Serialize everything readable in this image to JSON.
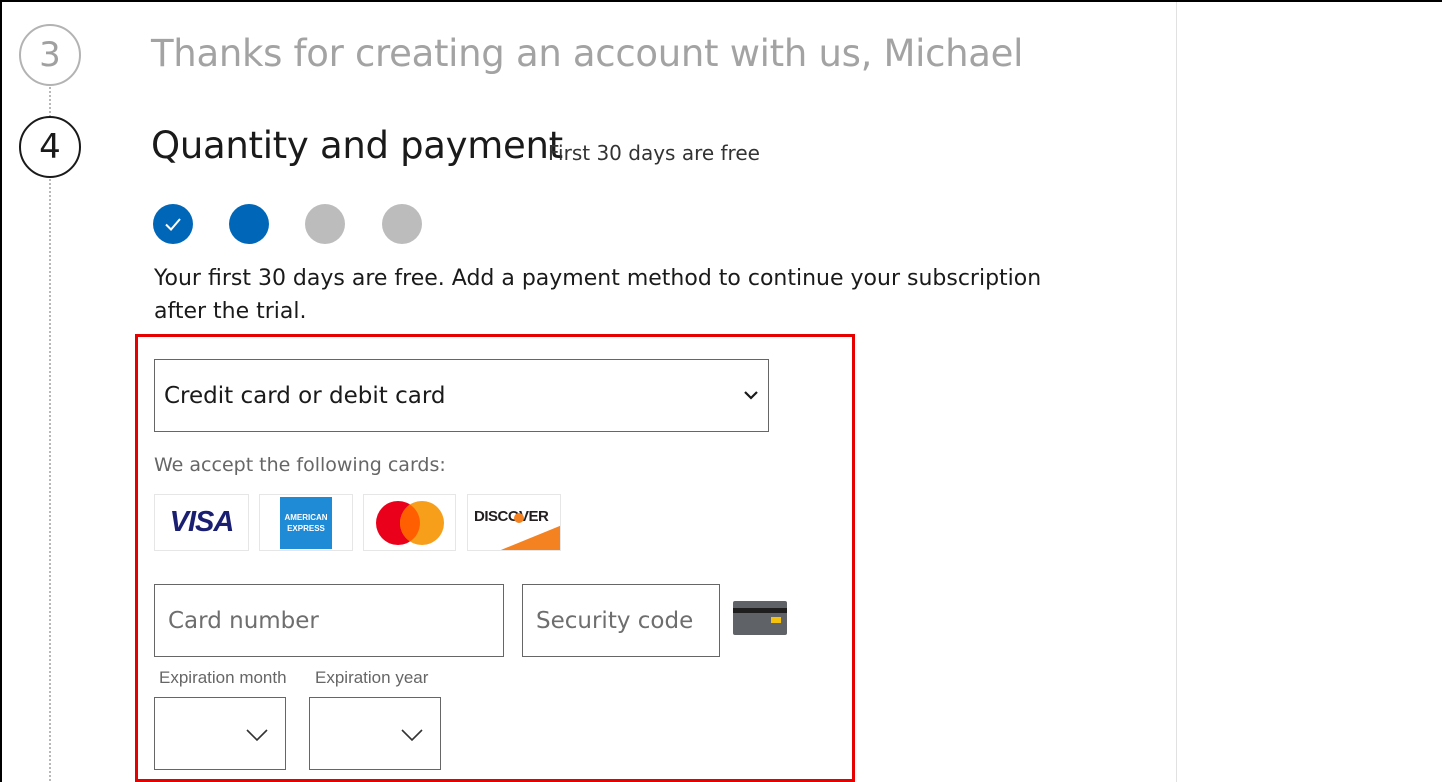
{
  "steps": {
    "step3": {
      "number": "3",
      "title": "Thanks for creating an account with us, Michael"
    },
    "step4": {
      "number": "4",
      "title": "Quantity and payment",
      "subtitle": "First 30 days are free"
    }
  },
  "progress": {
    "total": 4,
    "completed": 1,
    "current": 2
  },
  "payment": {
    "intro_text": "Your first 30 days are free. Add a payment method to continue your subscription after the trial.",
    "method_selected": "Credit card or debit card",
    "accept_label": "We accept the following cards:",
    "cards": {
      "visa": "VISA",
      "amex_line1": "AMERICAN",
      "amex_line2": "EXPRESS",
      "discover": "DISCOVER"
    },
    "card_number_placeholder": "Card number",
    "security_code_placeholder": "Security code",
    "expiration_month_label": "Expiration month",
    "expiration_year_label": "Expiration year"
  },
  "colors": {
    "accent": "#0067b8",
    "highlight": "#e60000",
    "inactive_dot": "#bcbcbc",
    "muted_text": "#a3a3a3"
  },
  "icons": {
    "check": "checkmark-icon",
    "chevron": "chevron-down-icon",
    "cvv": "card-back-icon"
  }
}
